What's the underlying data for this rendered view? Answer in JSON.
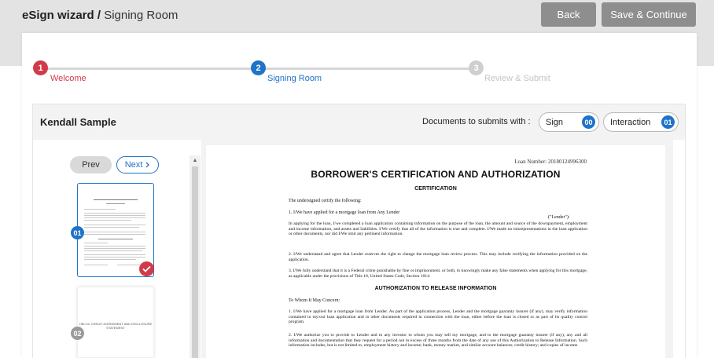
{
  "header": {
    "wizard": "eSign wizard",
    "separator": " / ",
    "section": "Signing Room",
    "back_label": "Back",
    "save_label": "Save & Continue"
  },
  "steps": [
    {
      "num": "1",
      "label": "Welcome"
    },
    {
      "num": "2",
      "label": "Signing Room"
    },
    {
      "num": "3",
      "label": "Review & Submit"
    }
  ],
  "panel": {
    "doc_name": "Kendall Sample",
    "submit_label": "Documents to submits with :",
    "sign_label": "Sign",
    "sign_count": "00",
    "interaction_label": "Interaction",
    "interaction_count": "01"
  },
  "nav": {
    "prev_label": "Prev",
    "next_label": "Next"
  },
  "thumbnails": [
    {
      "num": "01"
    },
    {
      "num": "02",
      "caption": "HELOC CREDIT AGREEMENT AND DISCLOSURE STATEMENT"
    }
  ],
  "document": {
    "loan_number": "Loan Number: 20180124996300",
    "title": "BORROWER'S CERTIFICATION AND AUTHORIZATION",
    "subtitle": "CERTIFICATION",
    "intro": "The undersigned certify the following:",
    "item1": "1.   I/We have applied for a mortgage loan from   Any Lender",
    "lender": "(\"Lender\"):",
    "para1": "In applying for the loan, I/we completed a loan application containing information on the purpose of the loan, the amount and source of the downpayment, employment and income information, and assets and liabilities. I/We certify that all of the information is true and complete. I/We made no misrepresentations in the loan application or other documents, nor did I/We omit any pertinent information.",
    "para2": "2.   I/We understand and agree that Lender reserves the right to change the mortgage loan review process. This may include verifying the information provided on the application.",
    "para3": "3.   I/We fully understand that it is a Federal crime punishable by fine or imprisonment, or both, to knowingly make any false statements when applying for this mortgage, as applicable under the provisions of Title 18, United States Code, Section 1014.",
    "section2": "AUTHORIZATION TO RELEASE INFORMATION",
    "to_whom": "To Whom It May Concern:",
    "para4": "1.   I/We have applied for a mortgage loan from Lender. As part of the application process, Lender and the mortgage guaranty insurer (if any), may verify information contained in my/our loan application and in other documents required in connection with the loan, either before the loan is closed or as part of its quality control program.",
    "para5": "2.   I/We authorize you to provide to Lender and to any investor to whom you may sell my mortgage, and to the mortgage guaranty insurer (if any), any and all information and documentation that they request for a period not in excess of three months from the date of any use of this Authorization to Release Information. Such information includes, but is not limited to, employment history and income; bank, money market, and similar account balances; credit history; and copies of income"
  }
}
